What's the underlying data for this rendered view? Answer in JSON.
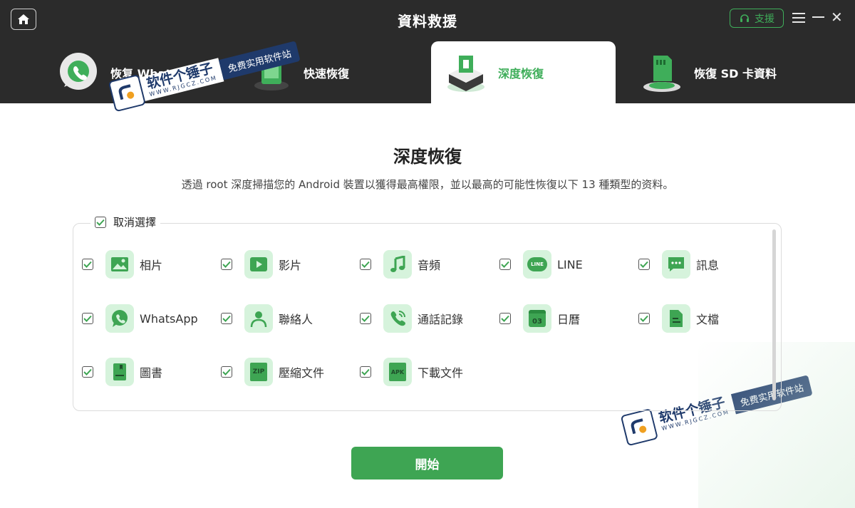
{
  "app": {
    "title": "資料救援",
    "support_label": "支援"
  },
  "tabs": [
    {
      "label": "恢复 WhatsApp"
    },
    {
      "label": "快速恢復"
    },
    {
      "label": "深度恢復"
    },
    {
      "label": "恢復 SD 卡資料"
    }
  ],
  "main": {
    "title": "深度恢復",
    "subtitle": "透過 root 深度掃描您的 Android 裝置以獲得最高權限，並以最高的可能性恢復以下 13 種類型的资料。",
    "deselect_label": "取消選擇",
    "start_label": "開始"
  },
  "items": [
    {
      "label": "相片",
      "checked": true,
      "icon": "photo-icon"
    },
    {
      "label": "影片",
      "checked": true,
      "icon": "video-icon"
    },
    {
      "label": "音頻",
      "checked": true,
      "icon": "music-icon"
    },
    {
      "label": "LINE",
      "checked": true,
      "icon": "line-icon"
    },
    {
      "label": "訊息",
      "checked": true,
      "icon": "message-icon"
    },
    {
      "label": "WhatsApp",
      "checked": true,
      "icon": "whatsapp-icon"
    },
    {
      "label": "聯絡人",
      "checked": true,
      "icon": "contact-icon"
    },
    {
      "label": "通話記錄",
      "checked": true,
      "icon": "call-log-icon"
    },
    {
      "label": "日曆",
      "checked": true,
      "icon": "calendar-icon"
    },
    {
      "label": "文檔",
      "checked": true,
      "icon": "document-icon"
    },
    {
      "label": "圖書",
      "checked": true,
      "icon": "book-icon"
    },
    {
      "label": "壓縮文件",
      "checked": true,
      "icon": "zip-icon"
    },
    {
      "label": "下載文件",
      "checked": true,
      "icon": "apk-icon"
    }
  ],
  "icon_glyphs": {
    "line": "LINE",
    "calendar": "03",
    "zip": "ZIP",
    "apk": "APK"
  },
  "watermark": {
    "main": "软件个锤子",
    "sub": "WWW.RJGCZ.COM",
    "slogan": "免费实用软件站"
  },
  "colors": {
    "accent": "#3ea553",
    "topbar": "#2b2b2b",
    "icon_bg": "#d6f3dc"
  }
}
